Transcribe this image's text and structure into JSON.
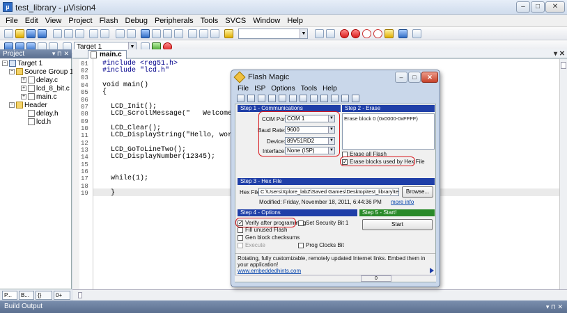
{
  "main_window": {
    "title": "test_library - µVision4",
    "controls": {
      "minimize": "–",
      "maximize": "□",
      "close": "✕"
    }
  },
  "menubar": [
    "File",
    "Edit",
    "View",
    "Project",
    "Flash",
    "Debug",
    "Peripherals",
    "Tools",
    "SVCS",
    "Window",
    "Help"
  ],
  "toolbar2": {
    "target_select": "Target 1"
  },
  "project_panel": {
    "title": "Project",
    "tree": [
      {
        "label": "Target 1",
        "level": 0
      },
      {
        "label": "Source Group 1",
        "level": 1
      },
      {
        "label": "delay.c",
        "level": 2
      },
      {
        "label": "lcd_8_bit.c",
        "level": 2
      },
      {
        "label": "main.c",
        "level": 2
      },
      {
        "label": "Header",
        "level": 1
      },
      {
        "label": "delay.h",
        "level": 2
      },
      {
        "label": "lcd.h",
        "level": 2
      }
    ],
    "tabs": [
      "P...",
      "B...",
      "{} F...",
      "0+ T..."
    ]
  },
  "editor": {
    "tab": "main.c",
    "lines": [
      {
        "n": "01",
        "text": "#include <reg51.h>"
      },
      {
        "n": "02",
        "text": "#include \"lcd.h\""
      },
      {
        "n": "03",
        "text": ""
      },
      {
        "n": "04",
        "text": "void main()"
      },
      {
        "n": "05",
        "text": "{"
      },
      {
        "n": "06",
        "text": ""
      },
      {
        "n": "07",
        "text": "  LCD_Init();"
      },
      {
        "n": "08",
        "text": "  LCD_ScrollMessage(\"   Welcome to 8051"
      },
      {
        "n": "09",
        "text": ""
      },
      {
        "n": "10",
        "text": "  LCD_Clear();"
      },
      {
        "n": "11",
        "text": "  LCD_DisplayString(\"Hello, world\");"
      },
      {
        "n": "12",
        "text": ""
      },
      {
        "n": "13",
        "text": "  LCD_GoToLineTwo();"
      },
      {
        "n": "14",
        "text": "  LCD_DisplayNumber(12345);"
      },
      {
        "n": "15",
        "text": ""
      },
      {
        "n": "16",
        "text": ""
      },
      {
        "n": "17",
        "text": "  while(1);"
      },
      {
        "n": "18",
        "text": ""
      },
      {
        "n": "19",
        "text": "  }"
      }
    ]
  },
  "build_output": {
    "title": "Build Output"
  },
  "flash_magic": {
    "title": "Flash Magic",
    "menu": [
      "File",
      "ISP",
      "Options",
      "Tools",
      "Help"
    ],
    "step1": {
      "header": "Step 1 - Communications",
      "com_port_label": "COM Port:",
      "com_port": "COM 1",
      "baud_rate_label": "Baud Rate:",
      "baud_rate": "9600",
      "device_label": "Device:",
      "device": "89V51RD2",
      "interface_label": "Interface:",
      "interface": "None (ISP)"
    },
    "step2": {
      "header": "Step 2 - Erase",
      "erase_list": "Erase block 0 (0x0000-0xFFFF)",
      "erase_all": "Erase all Flash",
      "erase_used": "Erase blocks used by Hex File"
    },
    "step3": {
      "header": "Step 3 - Hex File",
      "hex_file_label": "Hex File:",
      "hex_file": "C:\\Users\\Xplore_labZ\\Saved Games\\Desktop\\test_library\\test_libr",
      "browse": "Browse...",
      "modified": "Modified: Friday, November 18, 2011, 6:44:36 PM",
      "more_info": "more info"
    },
    "step4": {
      "header": "Step 4 - Options",
      "verify": "Verify after programming",
      "security": "Set Security Bit 1",
      "fill_unused": "Fill unused Flash",
      "gen_checksums": "Gen block checksums",
      "execute": "Execute",
      "prog_clocks": "Prog Clocks Bit"
    },
    "step5": {
      "header": "Step 5 - Start!",
      "start": "Start"
    },
    "footer": {
      "message": "Rotating, fully customizable, remotely updated Internet links. Embed them in your application!",
      "link": "www.embeddedhints.com",
      "status": "0"
    }
  },
  "colors": {
    "step_header": "#1f3fa8",
    "step5_header": "#2a8a2a",
    "annotation": "#d8191f"
  }
}
